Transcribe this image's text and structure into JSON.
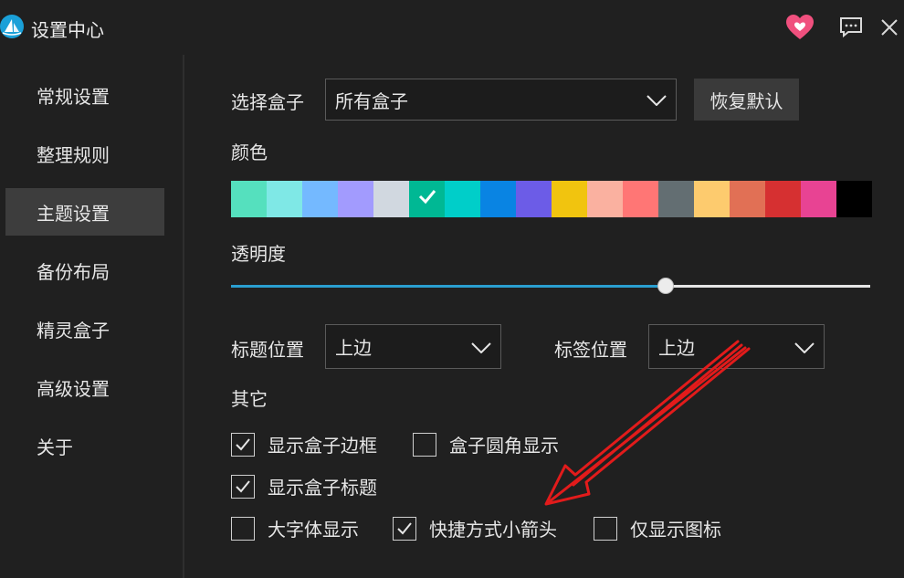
{
  "window": {
    "title": "设置中心"
  },
  "colors": {
    "accent": "#2a9fd0",
    "heart": "#f0507e"
  },
  "sidebar": {
    "items": [
      {
        "label": "常规设置",
        "active": false
      },
      {
        "label": "整理规则",
        "active": false
      },
      {
        "label": "主题设置",
        "active": true
      },
      {
        "label": "备份布局",
        "active": false
      },
      {
        "label": "精灵盒子",
        "active": false
      },
      {
        "label": "高级设置",
        "active": false
      },
      {
        "label": "关于",
        "active": false
      }
    ]
  },
  "main": {
    "box_select": {
      "label": "选择盒子",
      "value": "所有盒子"
    },
    "reset_button": "恢复默认",
    "color": {
      "label": "颜色",
      "swatches": [
        "#55e0be",
        "#7fe8e6",
        "#74b9ff",
        "#a29bfe",
        "#d1d8e0",
        "#00b894",
        "#00cec9",
        "#0984e3",
        "#6c5ce7",
        "#f1c40f",
        "#fab1a0",
        "#ff7675",
        "#636e72",
        "#fdcb6e",
        "#e17055",
        "#d63031",
        "#e84393",
        "#000000"
      ],
      "selected_index": 5
    },
    "opacity": {
      "label": "透明度",
      "value_fraction": 0.68
    },
    "title_position": {
      "label": "标题位置",
      "value": "上边"
    },
    "tag_position": {
      "label": "标签位置",
      "value": "上边"
    },
    "other": {
      "label": "其它",
      "options": [
        {
          "label": "显示盒子边框",
          "checked": true
        },
        {
          "label": "盒子圆角显示",
          "checked": false
        },
        {
          "label": "显示盒子标题",
          "checked": true
        },
        {
          "label": "大字体显示",
          "checked": false
        },
        {
          "label": "快捷方式小箭头",
          "checked": true
        },
        {
          "label": "仅显示图标",
          "checked": false
        }
      ]
    }
  }
}
